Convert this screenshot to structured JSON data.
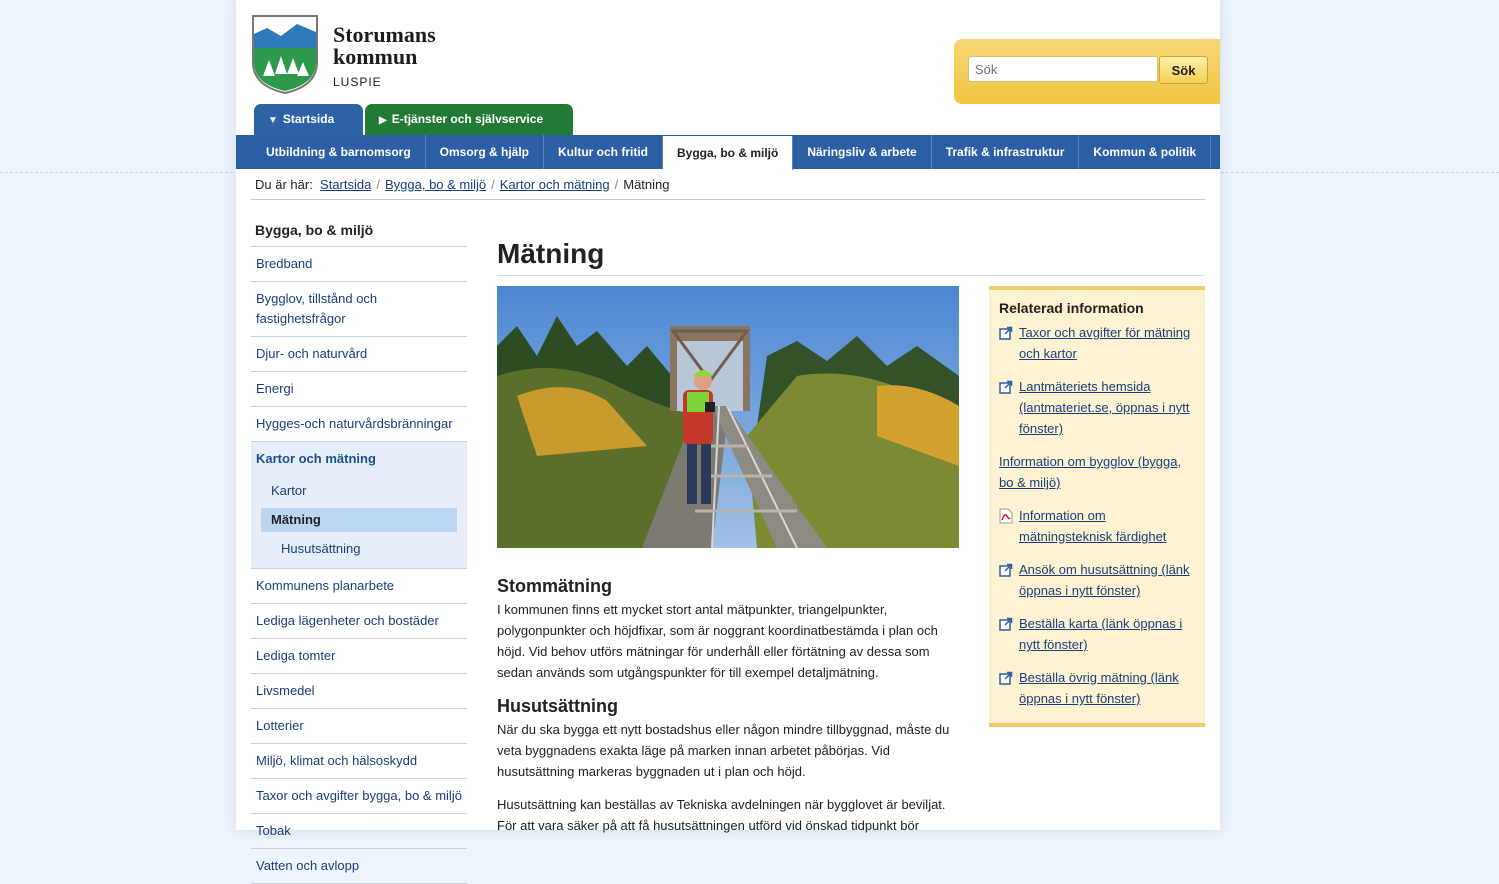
{
  "site": {
    "name_line1": "Storumans",
    "name_line2": "kommun",
    "subtitle": "LUSPIE"
  },
  "search": {
    "placeholder": "Sök",
    "button": "Sök"
  },
  "top_tabs": [
    {
      "label": "Startsida",
      "icon": "triangle-down-icon"
    },
    {
      "label": "E-tjänster och självservice",
      "icon": "triangle-right-icon"
    }
  ],
  "main_nav": [
    "Utbildning & barnomsorg",
    "Omsorg & hjälp",
    "Kultur och fritid",
    "Bygga, bo & miljö",
    "Näringsliv & arbete",
    "Trafik & infrastruktur",
    "Kommun & politik"
  ],
  "breadcrumb": {
    "prefix": "Du är här:",
    "items": [
      "Startsida",
      "Bygga, bo & miljö",
      "Kartor och mätning",
      "Mätning"
    ]
  },
  "sidebar": {
    "heading": "Bygga, bo & miljö",
    "items_before": [
      "Bredband",
      "Bygglov, tillstånd och fastighetsfrågor",
      "Djur- och naturvård",
      "Energi",
      "Hygges-och naturvårdsbränningar"
    ],
    "group": {
      "title": "Kartor och mätning",
      "sub1": "Kartor",
      "current": "Mätning",
      "sub2": "Husutsättning"
    },
    "items_after": [
      "Kommunens planarbete",
      "Lediga lägenheter och bostäder",
      "Lediga tomter",
      "Livsmedel",
      "Lotterier",
      "Miljö, klimat och hälsoskydd",
      "Taxor och avgifter bygga, bo & miljö",
      "Tobak",
      "Vatten och avlopp"
    ]
  },
  "page": {
    "title": "Mätning",
    "sections": [
      {
        "heading": "Stommätning",
        "paragraphs": [
          "I kommunen finns ett mycket stort antal mätpunkter, triangelpunkter, polygonpunkter och höjdfixar, som är noggrant koordinatbestämda i plan och höjd. Vid behov utförs mätningar för underhåll eller förtätning av dessa som sedan används som utgångspunkter för till exempel detaljmätning."
        ]
      },
      {
        "heading": "Husutsättning",
        "paragraphs": [
          "När du ska bygga ett nytt bostadshus eller någon mindre tillbyggnad, måste du veta byggnadens exakta läge på marken innan arbetet påbörjas. Vid husutsättning markeras byggnaden ut i plan och höjd.",
          "Husutsättning kan beställas av Tekniska avdelningen när bygglovet är beviljat. För att vara säker på att få husutsättningen utförd vid önskad tidpunkt bör"
        ]
      }
    ]
  },
  "related": {
    "heading": "Relaterad information",
    "links": [
      {
        "label": "Taxor och avgifter för mätning och kartor",
        "icon": "external-link-icon"
      },
      {
        "label": "Lantmäteriets hemsida (lantmateriet.se, öppnas i nytt fönster)",
        "icon": "external-link-icon"
      },
      {
        "label": "Information om bygglov (bygga, bo & miljö)",
        "icon": ""
      },
      {
        "label": "Information om mätningsteknisk färdighet",
        "icon": "pdf-icon"
      },
      {
        "label": "Ansök om husutsättning (länk öppnas i nytt fönster)",
        "icon": "external-link-icon"
      },
      {
        "label": "Beställa karta (länk öppnas i nytt fönster)",
        "icon": "external-link-icon"
      },
      {
        "label": "Beställa övrig mätning (länk öppnas i nytt fönster)",
        "icon": "external-link-icon"
      }
    ]
  },
  "colors": {
    "nav_blue": "#2c5fa3",
    "eservice_green": "#227a35",
    "search_yellow": "#f1c542",
    "related_bg": "#fdf3d3"
  }
}
